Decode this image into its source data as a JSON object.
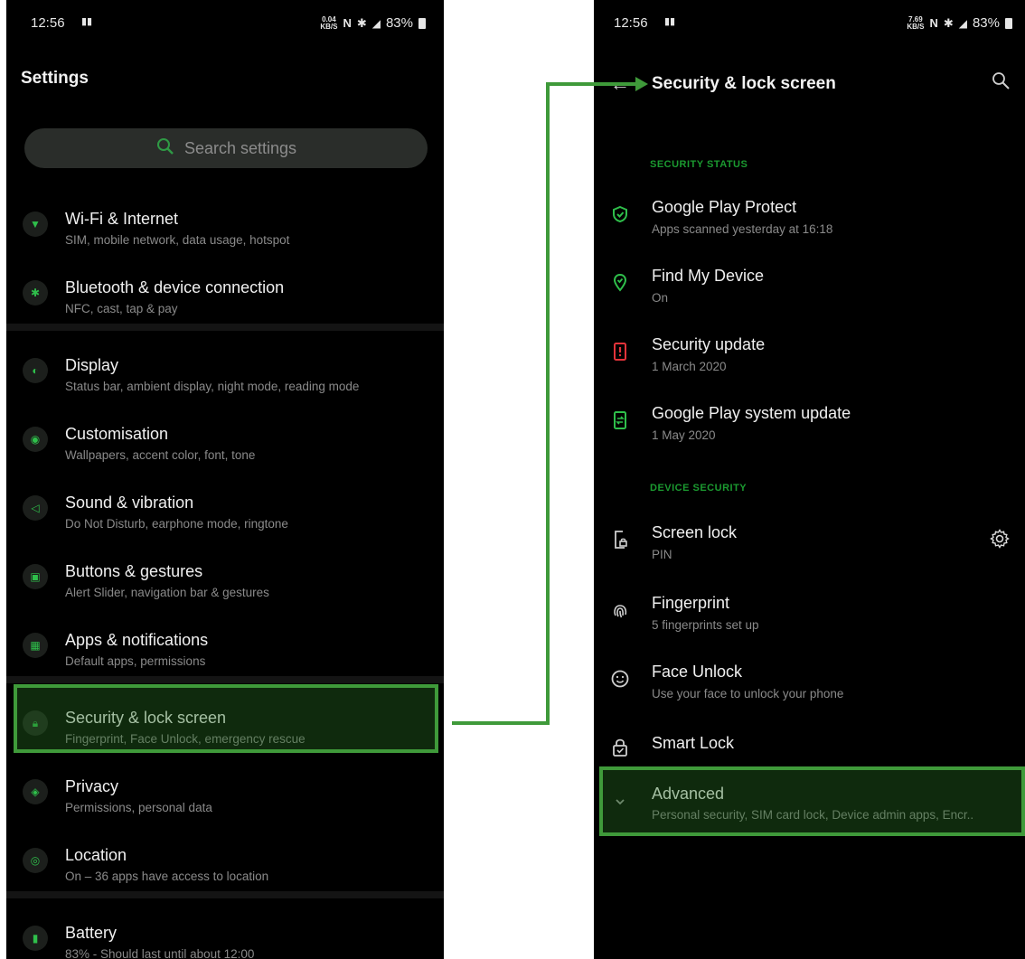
{
  "left": {
    "status": {
      "time": "12:56",
      "speed_top": "0.04",
      "speed_unit": "KB/S",
      "battery": "83%"
    },
    "title": "Settings",
    "search_placeholder": "Search settings",
    "items": [
      {
        "title": "Wi-Fi & Internet",
        "subtitle": "SIM, mobile network, data usage, hotspot",
        "icon": "wifi-icon"
      },
      {
        "title": "Bluetooth & device connection",
        "subtitle": "NFC, cast, tap & pay",
        "icon": "bluetooth-icon"
      },
      {
        "title": "Display",
        "subtitle": "Status bar, ambient display, night mode, reading mode",
        "icon": "display-icon"
      },
      {
        "title": "Customisation",
        "subtitle": "Wallpapers, accent color, font, tone",
        "icon": "palette-icon"
      },
      {
        "title": "Sound & vibration",
        "subtitle": "Do Not Disturb, earphone mode, ringtone",
        "icon": "speaker-icon"
      },
      {
        "title": "Buttons & gestures",
        "subtitle": "Alert Slider, navigation bar & gestures",
        "icon": "gesture-icon"
      },
      {
        "title": "Apps & notifications",
        "subtitle": "Default apps, permissions",
        "icon": "apps-icon"
      },
      {
        "title": "Security & lock screen",
        "subtitle": "Fingerprint, Face Unlock, emergency rescue",
        "icon": "lock-icon"
      },
      {
        "title": "Privacy",
        "subtitle": "Permissions, personal data",
        "icon": "shield-icon"
      },
      {
        "title": "Location",
        "subtitle": "On – 36 apps have access to location",
        "icon": "location-icon"
      },
      {
        "title": "Battery",
        "subtitle": "83% - Should last until about 12:00",
        "icon": "battery-icon"
      }
    ]
  },
  "right": {
    "status": {
      "time": "12:56",
      "speed_top": "7.69",
      "speed_unit": "KB/S",
      "battery": "83%"
    },
    "title": "Security & lock screen",
    "sections": {
      "security_status": "SECURITY STATUS",
      "device_security": "DEVICE SECURITY"
    },
    "items": [
      {
        "title": "Google Play Protect",
        "subtitle": "Apps scanned yesterday at 16:18",
        "icon": "shield-check-icon"
      },
      {
        "title": "Find My Device",
        "subtitle": "On",
        "icon": "location-pin-icon"
      },
      {
        "title": "Security update",
        "subtitle": "1 March 2020",
        "icon": "phone-alert-icon"
      },
      {
        "title": "Google Play system update",
        "subtitle": "1 May 2020",
        "icon": "phone-sync-icon"
      },
      {
        "title": "Screen lock",
        "subtitle": "PIN",
        "icon": "screen-lock-icon"
      },
      {
        "title": "Fingerprint",
        "subtitle": "5 fingerprints set up",
        "icon": "fingerprint-icon"
      },
      {
        "title": "Face Unlock",
        "subtitle": "Use your face to unlock your phone",
        "icon": "face-icon"
      },
      {
        "title": "Smart Lock",
        "subtitle": "",
        "icon": "smart-lock-icon"
      },
      {
        "title": "Advanced",
        "subtitle": "Personal security, SIM card lock, Device admin apps, Encr..",
        "icon": "chevron-down-icon"
      }
    ]
  },
  "colors": {
    "accent": "#2fbf4b",
    "highlight": "#3f9a3a",
    "alert": "#e2333a"
  }
}
